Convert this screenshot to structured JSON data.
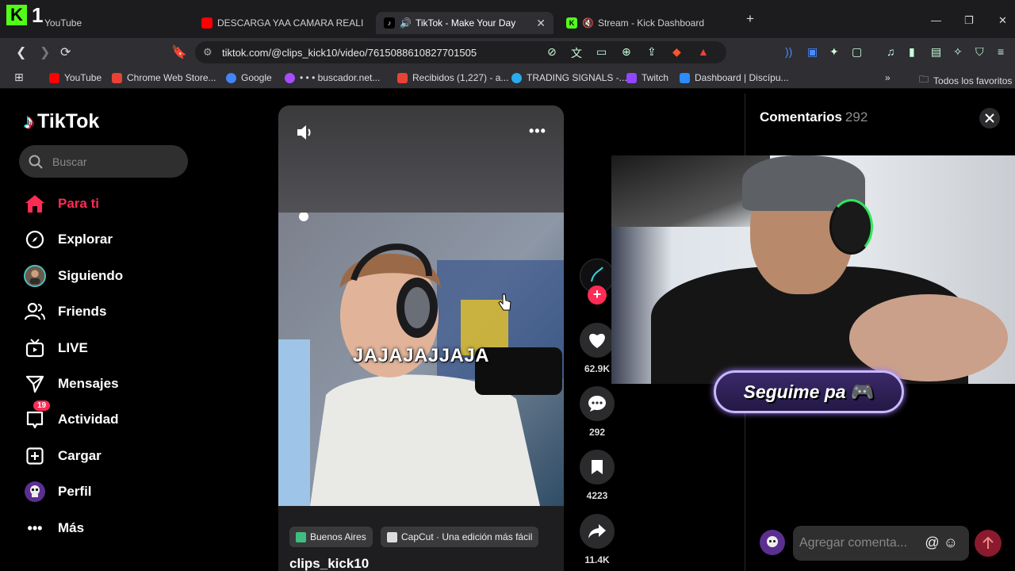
{
  "browser": {
    "overlay_number": "1",
    "tabs": [
      {
        "title": "YouTube",
        "favicon_color": "#ff0000"
      },
      {
        "title": "DESCARGA YAA CAMARA REALISTA (",
        "favicon_color": "#ff0000"
      },
      {
        "title": "TikTok - Make Your Day",
        "favicon_color": "#000000"
      },
      {
        "title": "Stream - Kick Dashboard",
        "favicon_color": "#53fc18"
      }
    ],
    "url": "tiktok.com/@clips_kick10/video/7615088610827701505",
    "bookmarks": [
      {
        "label": "YouTube",
        "color": "#ff0000"
      },
      {
        "label": "Chrome Web Store...",
        "color": "#e94235"
      },
      {
        "label": "Google",
        "color": "#4285f4"
      },
      {
        "label": "• • • buscador.net...",
        "color": "#a64dff"
      },
      {
        "label": "Recibidos (1,227) - a...",
        "color": "#ea4335"
      },
      {
        "label": "TRADING SIGNALS -...",
        "color": "#2aabee"
      },
      {
        "label": "Twitch",
        "color": "#9146ff"
      },
      {
        "label": "Dashboard | Discípu...",
        "color": "#2a8cff"
      }
    ],
    "all_bookmarks_label": "Todos los favoritos"
  },
  "sidebar": {
    "logo": "TikTok",
    "search_placeholder": "Buscar",
    "items": [
      {
        "label": "Para ti",
        "icon": "home-icon"
      },
      {
        "label": "Explorar",
        "icon": "compass-icon"
      },
      {
        "label": "Siguiendo",
        "icon": "following-avatar-icon"
      },
      {
        "label": "Friends",
        "icon": "friends-icon"
      },
      {
        "label": "LIVE",
        "icon": "live-icon"
      },
      {
        "label": "Mensajes",
        "icon": "send-icon"
      },
      {
        "label": "Actividad",
        "icon": "inbox-icon",
        "badge": "19"
      },
      {
        "label": "Cargar",
        "icon": "upload-icon"
      },
      {
        "label": "Perfil",
        "icon": "profile-icon"
      },
      {
        "label": "Más",
        "icon": "more-icon"
      }
    ]
  },
  "video": {
    "caption": "JAJAJAJJAJA",
    "location": "Buenos Aires",
    "capcut": "CapCut · Una edición más fácil",
    "author": "clips_kick10"
  },
  "actions": {
    "likes": "62.9K",
    "comments": "292",
    "saves": "4223",
    "shares": "11.4K"
  },
  "comments_panel": {
    "title": "Comentarios",
    "count": "292",
    "input_placeholder": "Agregar comenta...",
    "overlay_text": "Seguime pa"
  },
  "colors": {
    "accent": "#fe2c55",
    "kick_green": "#53fc18"
  }
}
